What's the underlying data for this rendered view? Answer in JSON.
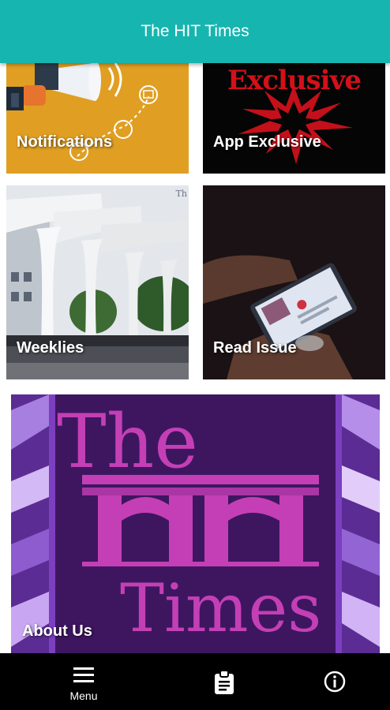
{
  "app_bar": {
    "title": "The HIT Times"
  },
  "tiles": {
    "notifications": {
      "label": "Notifications",
      "icon": "megaphone-icon"
    },
    "exclusive": {
      "label": "App Exclusive",
      "banner_word": "Exclusive"
    },
    "weeklies": {
      "label": "Weeklies",
      "banner_letters": "Th"
    },
    "read_issue": {
      "label": "Read Issue"
    },
    "about": {
      "label": "About Us",
      "logo_the": "The",
      "logo_times": "Times"
    }
  },
  "bottom_nav": {
    "menu": {
      "label": "Menu",
      "icon": "hamburger-menu-icon"
    },
    "issues": {
      "icon": "clipboard-icon"
    },
    "info": {
      "icon": "info-icon"
    }
  },
  "colors": {
    "app_bar": "#16b5b0",
    "notifications_bg": "#e09f22",
    "exclusive_red": "#d4101a",
    "about_purple": "#3a1359",
    "logo_pink": "#c43fb5",
    "bottom_nav": "#000000"
  }
}
